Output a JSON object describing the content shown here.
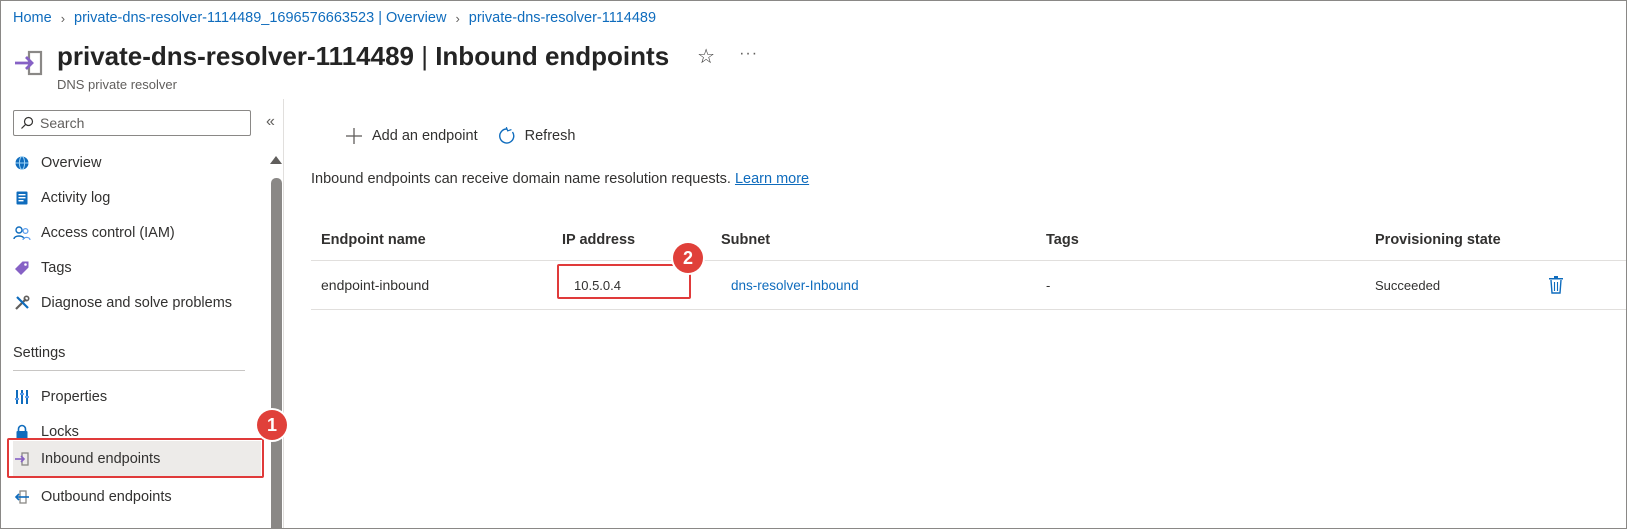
{
  "breadcrumb": {
    "items": [
      "Home",
      "private-dns-resolver-1114489_1696576663523 | Overview",
      "private-dns-resolver-1114489"
    ]
  },
  "header": {
    "resource_name": "private-dns-resolver-1114489",
    "page_name": "Inbound endpoints",
    "separator": " | ",
    "subtitle": "DNS private resolver",
    "star_icon": "star-icon",
    "more": "···"
  },
  "sidebar": {
    "search_placeholder": "Search",
    "collapse_glyph": "«",
    "items": [
      {
        "label": "Overview",
        "icon": "globe-icon"
      },
      {
        "label": "Activity log",
        "icon": "document-icon"
      },
      {
        "label": "Access control (IAM)",
        "icon": "people-icon"
      },
      {
        "label": "Tags",
        "icon": "tag-icon"
      },
      {
        "label": "Diagnose and solve problems",
        "icon": "wrench-icon"
      }
    ],
    "settings_heading": "Settings",
    "settings_items": [
      {
        "label": "Properties",
        "icon": "properties-icon"
      },
      {
        "label": "Locks",
        "icon": "lock-icon"
      },
      {
        "label": "Inbound endpoints",
        "icon": "inbound-icon",
        "selected": true
      },
      {
        "label": "Outbound endpoints",
        "icon": "outbound-icon"
      }
    ]
  },
  "toolbar": {
    "add_label": "Add an endpoint",
    "refresh_label": "Refresh"
  },
  "description": {
    "text": "Inbound endpoints can receive domain name resolution requests.",
    "link": "Learn more"
  },
  "table": {
    "columns": [
      "Endpoint name",
      "IP address",
      "Subnet",
      "Tags",
      "Provisioning state"
    ],
    "rows": [
      {
        "name": "endpoint-inbound",
        "ip": "10.5.0.4",
        "subnet": "dns-resolver-Inbound",
        "tags": "-",
        "state": "Succeeded"
      }
    ]
  },
  "annotations": {
    "badge1": "1",
    "badge2": "2"
  },
  "colors": {
    "link": "#0f6cbd",
    "highlight": "#e03a3a",
    "accent_purple": "#8661c5"
  }
}
